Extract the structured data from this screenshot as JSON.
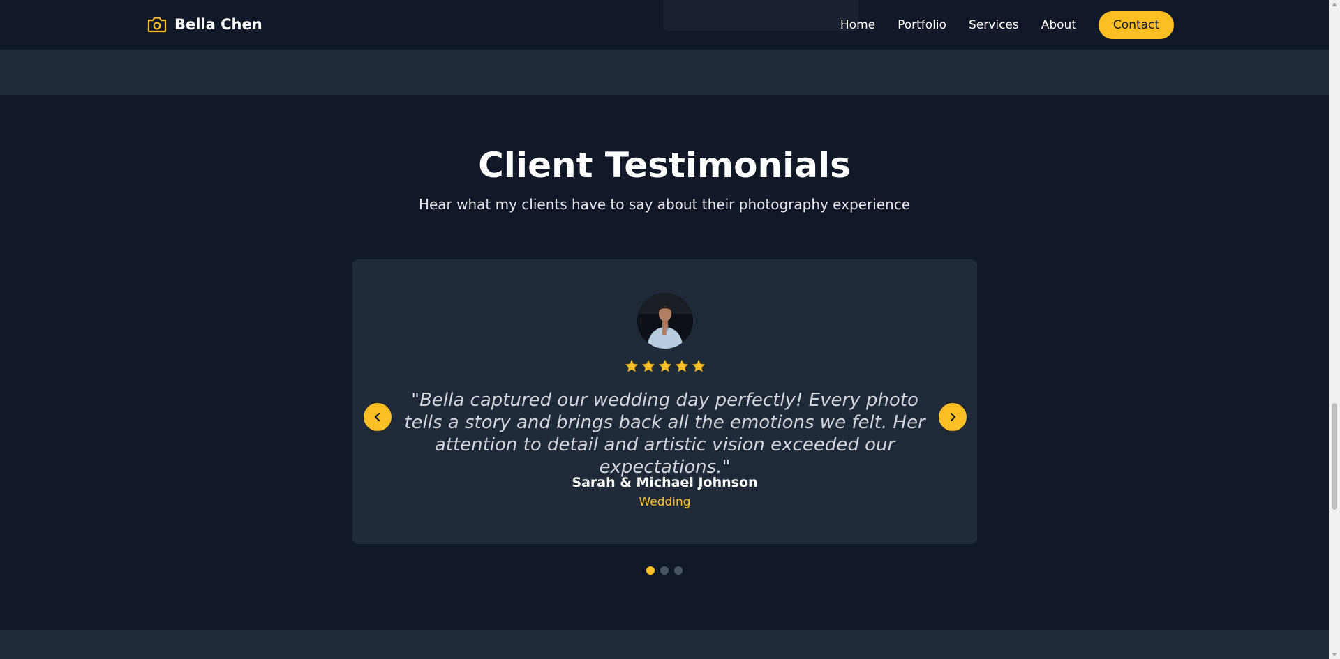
{
  "header": {
    "brand": "Bella Chen",
    "logo_icon": "camera-icon",
    "nav": [
      {
        "label": "Home"
      },
      {
        "label": "Portfolio"
      },
      {
        "label": "Services"
      },
      {
        "label": "About"
      }
    ],
    "contact_label": "Contact"
  },
  "testimonials": {
    "title": "Client Testimonials",
    "subtitle": "Hear what my clients have to say about their photography experience",
    "current": {
      "rating": 5,
      "quote": "\"Bella captured our wedding day perfectly! Every photo tells a story and brings back all the emotions we felt. Her attention to detail and artistic vision exceeded our expectations.\"",
      "name": "Sarah & Michael Johnson",
      "type": "Wedding"
    },
    "prev_icon": "chevron-left-icon",
    "next_icon": "chevron-right-icon",
    "slide_count": 3,
    "active_slide": 1
  },
  "colors": {
    "accent": "#fbbf24",
    "background": "#111827",
    "surface": "#1f2937",
    "text": "#ffffff",
    "muted_text": "#d1d5db",
    "inactive_dot": "#4b5563"
  }
}
